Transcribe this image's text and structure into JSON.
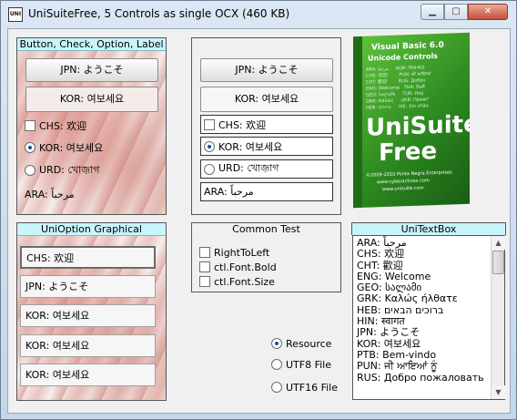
{
  "window": {
    "title": "UniSuiteFree, 5 Controls as single OCX (460 KB)",
    "icon_text": "UNI"
  },
  "frame1": {
    "title": "Button, Check, Option, Label",
    "button_jpn": "JPN: ようこそ",
    "button_kor": "KOR: 여보세요",
    "check_chs": "CHS: 欢迎",
    "option_kor": "KOR: 여보세요",
    "option_urd": "URD: খোজ়াগ",
    "label_ara": "ARA: مرحباً"
  },
  "frame2": {
    "button_jpn": "JPN: ようこそ",
    "button_kor": "KOR: 여보세요",
    "check_chs": "CHS: 欢迎",
    "option_kor": "KOR: 여보세요",
    "option_urd": "URD: খোজ়াগ",
    "label_ara": "ARA: مرحباً"
  },
  "logo": {
    "line1": "Visual Basic 6.0",
    "line2": "Unicode Controls",
    "languages": "ARA: مرحبا     KOR: 여보세요\nCHS: 欢迎        PUN: ਜੀ ਆਇਆਂ\nCHT: 歡迎        RUS: Добро\nENG: Welcome   THA: ยินดี\nGEO: სალამი     TUR: Hoş\nGRK: Καλώς     UKR: Привіт\nHEB: ברוכים     VIE: Xin chào",
    "name1": "UniSuite",
    "name2": "Free",
    "copyright": "©2009-2010 Ponta Negra Enterprises",
    "url1": "www.cyberactivex.com",
    "url2": "www.unisuite.com"
  },
  "option_graphical": {
    "title": "UniOption Graphical",
    "items": [
      "CHS: 欢迎",
      "JPN: ようこそ",
      "KOR: 여보세요",
      "KOR: 여보세요",
      "KOR: 여보세요"
    ]
  },
  "common_test": {
    "title": "Common Test",
    "checks": [
      "RightToLeft",
      "ctl.Font.Bold",
      "ctl.Font.Size"
    ]
  },
  "source_options": {
    "items": [
      "Resource",
      "UTF8 File",
      "UTF16 File"
    ],
    "selected": "Resource"
  },
  "textbox": {
    "title": "UniTextBox",
    "lines": [
      "ARA: مرحباً",
      "CHS: 欢迎",
      "CHT: 歡迎",
      "ENG: Welcome",
      "GEO: სალამი",
      "GRK: Καλώς ήλθατε",
      "HEB: ברוכים הבאים",
      "HIN: स्वागत",
      "JPN: ようこそ",
      "KOR: 여보세요",
      "PTB: Bem-vindo",
      "PUN: ਜੀ ਆਇਆਂ ਨੂੰ",
      "RUS: Добро пожаловать"
    ]
  }
}
